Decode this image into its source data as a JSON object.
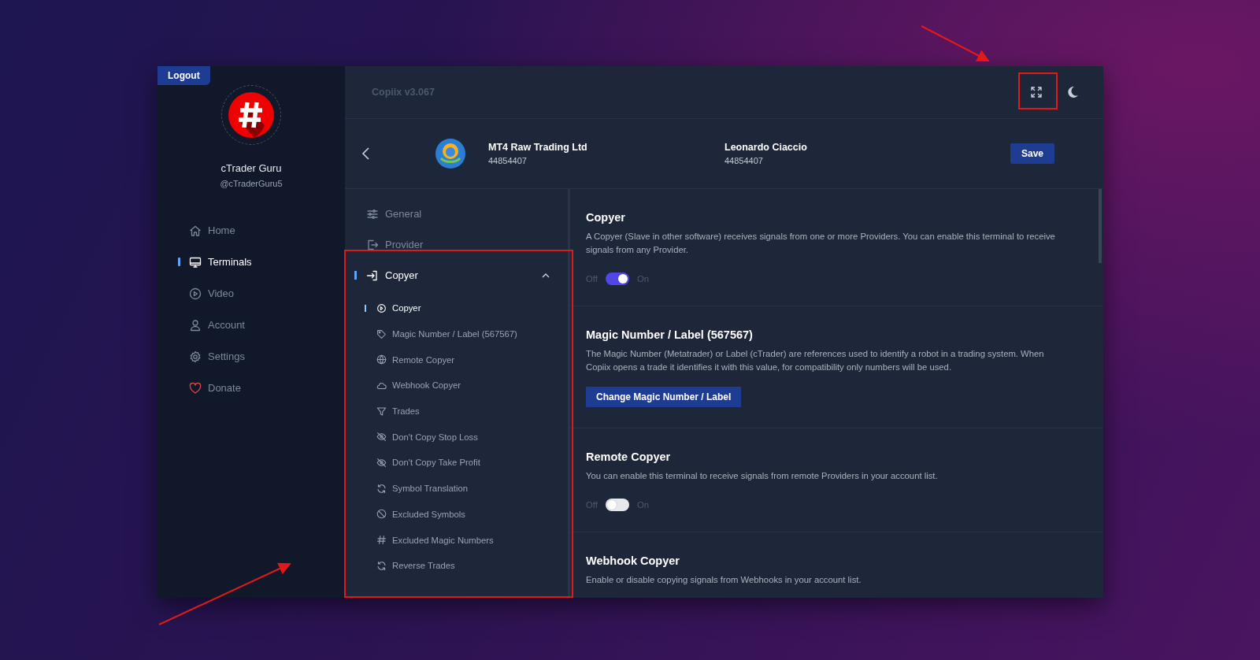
{
  "logout_button": "Logout",
  "profile": {
    "name": "cTrader Guru",
    "handle": "@cTraderGuru5"
  },
  "sidebar": {
    "items": [
      {
        "label": "Home",
        "selected": false
      },
      {
        "label": "Terminals",
        "selected": true
      },
      {
        "label": "Video",
        "selected": false
      },
      {
        "label": "Account",
        "selected": false
      },
      {
        "label": "Settings",
        "selected": false
      },
      {
        "label": "Donate",
        "selected": false
      }
    ]
  },
  "app": {
    "version": "Copiix v3.067"
  },
  "account": {
    "broker": "MT4 Raw Trading Ltd",
    "broker_number": "44854407",
    "owner": "Leonardo Ciaccio",
    "owner_number": "44854407",
    "save_button": "Save"
  },
  "settings_nav": {
    "items": [
      {
        "label": "General",
        "selected": false
      },
      {
        "label": "Provider",
        "selected": false
      },
      {
        "label": "Copyer",
        "selected": true,
        "expanded": true,
        "children": [
          {
            "label": "Copyer",
            "selected": true
          },
          {
            "label": "Magic Number / Label (567567)",
            "selected": false
          },
          {
            "label": "Remote Copyer",
            "selected": false
          },
          {
            "label": "Webhook Copyer",
            "selected": false
          },
          {
            "label": "Trades",
            "selected": false
          },
          {
            "label": "Don't Copy Stop Loss",
            "selected": false
          },
          {
            "label": "Don't Copy Take Profit",
            "selected": false
          },
          {
            "label": "Symbol Translation",
            "selected": false
          },
          {
            "label": "Excluded Symbols",
            "selected": false
          },
          {
            "label": "Excluded Magic Numbers",
            "selected": false
          },
          {
            "label": "Reverse Trades",
            "selected": false
          }
        ]
      }
    ]
  },
  "sections": [
    {
      "kind": "toggle",
      "title": "Copyer",
      "description": "A Copyer (Slave in other software) receives signals from one or more Providers. You can enable this terminal to receive signals from any Provider.",
      "off_label": "Off",
      "on_label": "On",
      "on": true
    },
    {
      "kind": "button",
      "title": "Magic Number / Label (567567)",
      "description": "The Magic Number (Metatrader) or Label (cTrader) are references used to identify a robot in a trading system. When Copiix opens a trade it identifies it with this value, for compatibility only numbers will be used.",
      "button": "Change Magic Number / Label"
    },
    {
      "kind": "toggle",
      "title": "Remote Copyer",
      "description": "You can enable this terminal to receive signals from remote Providers in your account list.",
      "off_label": "Off",
      "on_label": "On",
      "on": false
    },
    {
      "kind": "text",
      "title": "Webhook Copyer",
      "description": "Enable or disable copying signals from Webhooks in your account list."
    }
  ]
}
